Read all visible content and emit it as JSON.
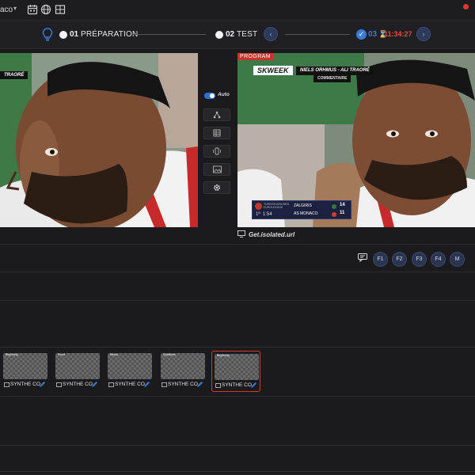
{
  "topbar": {
    "app_name": "aco",
    "caret": "▾",
    "icons": [
      "calendar-icon",
      "globe-icon",
      "layout-icon"
    ]
  },
  "steps": [
    {
      "number": "01",
      "label": "PRÉPARATION"
    },
    {
      "number": "02",
      "label": "TEST"
    },
    {
      "number": "03",
      "label": ""
    }
  ],
  "timer": "11:34:27",
  "preview": {
    "name_tag": "TRAORÉ"
  },
  "program": {
    "tag": "PROGRAM",
    "lower_third": {
      "brand": "SKWEEK",
      "name": "NIELS ORHMUS - ALI TRAORÉ",
      "role": "COMMENTAIRE"
    },
    "scoreboard": {
      "competition": "TURKISH AIRLINES EUROLEAGUE",
      "clock": "1:54",
      "period": "1ª",
      "teams": [
        {
          "name": "ZALGIRIS",
          "score": "14"
        },
        {
          "name": "AS MONACO",
          "score": "11"
        }
      ]
    },
    "url": "Get.isolated.url"
  },
  "side_controls": {
    "auto_label": "Auto",
    "buttons": [
      "network-icon",
      "grid-icon",
      "audio-icon",
      "image-icon",
      "gear-icon"
    ]
  },
  "function_keys": [
    "F1",
    "F2",
    "F3",
    "F4",
    "M"
  ],
  "cards": [
    {
      "thumb_label": "Beginning",
      "label": "SYNTHE CO",
      "active": false
    },
    {
      "thumb_label": "Score",
      "label": "SYNTHE CO",
      "active": false
    },
    {
      "thumb_label": "Mezzo",
      "label": "SYNTHE CO",
      "active": false
    },
    {
      "thumb_label": "Questions",
      "label": "SYNTHE CO",
      "active": false
    },
    {
      "thumb_label": "Beginning",
      "label": "SYNTHE CO",
      "active": true
    }
  ],
  "colors": {
    "accent_blue": "#3a7bd5",
    "alert_red": "#e84a3b",
    "program_red": "#c8352b"
  }
}
